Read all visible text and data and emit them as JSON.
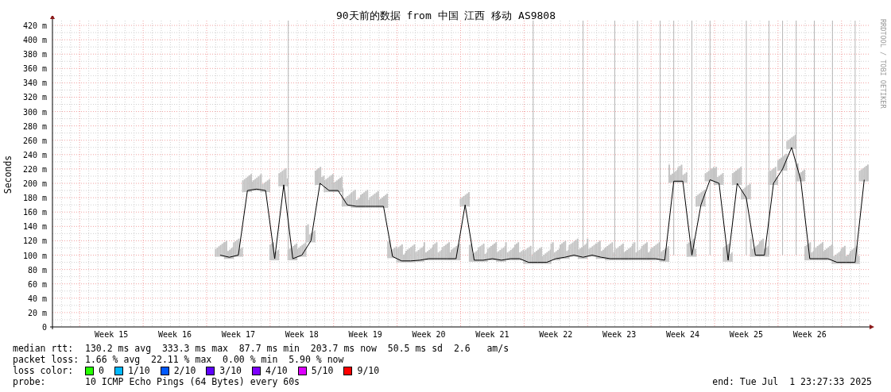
{
  "graph": {
    "title": "90天前的数据 from 中国 江西 移动 AS9808",
    "watermark": "RRDTOOL / TOBI OETIKER",
    "chart_data": {
      "type": "line",
      "grid": true,
      "ylabel": "Seconds",
      "ylim": [
        0,
        420
      ],
      "yticks": [
        {
          "value": 0,
          "label": "0"
        },
        {
          "value": 20,
          "label": "20 m"
        },
        {
          "value": 40,
          "label": "40 m"
        },
        {
          "value": 60,
          "label": "60 m"
        },
        {
          "value": 80,
          "label": "80 m"
        },
        {
          "value": 100,
          "label": "100 m"
        },
        {
          "value": 120,
          "label": "120 m"
        },
        {
          "value": 140,
          "label": "140 m"
        },
        {
          "value": 160,
          "label": "160 m"
        },
        {
          "value": 180,
          "label": "180 m"
        },
        {
          "value": 200,
          "label": "200 m"
        },
        {
          "value": 220,
          "label": "220 m"
        },
        {
          "value": 240,
          "label": "240 m"
        },
        {
          "value": 260,
          "label": "260 m"
        },
        {
          "value": 280,
          "label": "280 m"
        },
        {
          "value": 300,
          "label": "300 m"
        },
        {
          "value": 320,
          "label": "320 m"
        },
        {
          "value": 340,
          "label": "340 m"
        },
        {
          "value": 360,
          "label": "360 m"
        },
        {
          "value": 380,
          "label": "380 m"
        },
        {
          "value": 400,
          "label": "400 m"
        },
        {
          "value": 420,
          "label": "420 m"
        }
      ],
      "categories": [
        null,
        null,
        null,
        null,
        null,
        null,
        "Week 15",
        null,
        null,
        null,
        null,
        null,
        null,
        "Week 16",
        null,
        null,
        null,
        null,
        null,
        null,
        "Week 17",
        null,
        null,
        null,
        null,
        null,
        null,
        "Week 18",
        null,
        null,
        null,
        null,
        null,
        null,
        "Week 19",
        null,
        null,
        null,
        null,
        null,
        null,
        "Week 20",
        null,
        null,
        null,
        null,
        null,
        null,
        "Week 21",
        null,
        null,
        null,
        null,
        null,
        null,
        "Week 22",
        null,
        null,
        null,
        null,
        null,
        null,
        "Week 23",
        null,
        null,
        null,
        null,
        null,
        null,
        "Week 24",
        null,
        null,
        null,
        null,
        null,
        null,
        "Week 25",
        null,
        null,
        null,
        null,
        null,
        null,
        "Week 26",
        null,
        null,
        null,
        null,
        null,
        null
      ],
      "series": [
        {
          "name": "median rtt:",
          "color": "#000000",
          "values": [
            null,
            null,
            null,
            null,
            null,
            null,
            null,
            null,
            null,
            null,
            null,
            null,
            null,
            null,
            null,
            null,
            null,
            null,
            100,
            97,
            100,
            190,
            192,
            190,
            95,
            198,
            95,
            100,
            120,
            200,
            190,
            190,
            170,
            168,
            168,
            168,
            168,
            98,
            92,
            92,
            93,
            95,
            95,
            95,
            95,
            170,
            93,
            93,
            95,
            93,
            95,
            95,
            90,
            90,
            90,
            95,
            97,
            100,
            97,
            100,
            97,
            95,
            95,
            95,
            95,
            95,
            95,
            93,
            203,
            203,
            100,
            170,
            205,
            200,
            93,
            200,
            180,
            100,
            100,
            200,
            220,
            250,
            205,
            95,
            95,
            95,
            90,
            90,
            90,
            205
          ]
        }
      ]
    }
  },
  "stats": [
    {
      "text": "130.2 ms avg  333.3 ms max  87.7 ms min  203.7 ms now  50.5 ms sd  2.6   am/s"
    },
    {
      "label": "packet loss:",
      "text": "1.66 % avg  22.11 % max  0.00 % min  5.90 % now"
    }
  ],
  "loss_legend": {
    "label": "loss color:",
    "items": [
      {
        "label": "0",
        "color": "#26ff00"
      },
      {
        "label": "1/10",
        "color": "#00b8ff"
      },
      {
        "label": "2/10",
        "color": "#0059ff"
      },
      {
        "label": "3/10",
        "color": "#5e00ff"
      },
      {
        "label": "4/10",
        "color": "#7e00ff"
      },
      {
        "label": "5/10",
        "color": "#dd00ff"
      },
      {
        "label": "9/10",
        "color": "#ff0000"
      }
    ]
  },
  "probe": {
    "label": "probe:",
    "text": "10 ICMP Echo Pings (64 Bytes) every 60s"
  },
  "end": "end: Tue Jul  1 23:27:33 2025"
}
